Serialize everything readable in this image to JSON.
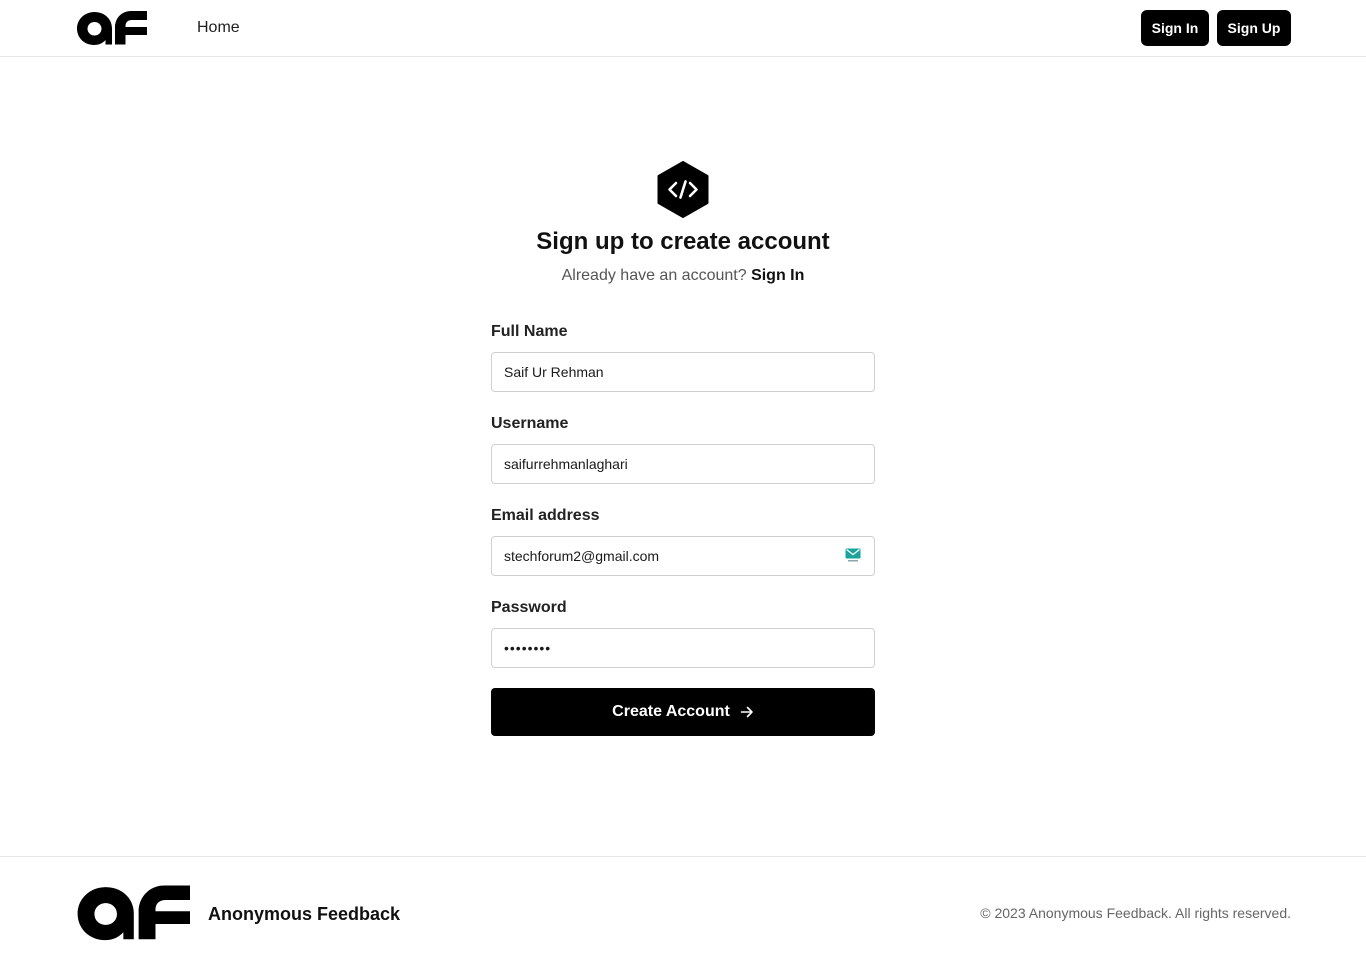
{
  "nav": {
    "logo_icon": "af-logo-icon",
    "home_label": "Home",
    "signin_label": "Sign In",
    "signup_label": "Sign Up"
  },
  "main": {
    "hero_icon": "code-hexagon-icon",
    "title": "Sign up to create account",
    "subtitle_prefix": "Already have an account?",
    "subtitle_link": "Sign In"
  },
  "form": {
    "fields": [
      {
        "label": "Full Name",
        "value": "Saif Ur Rehman"
      },
      {
        "label": "Username",
        "value": "saifurrehmanlaghari"
      },
      {
        "label": "Email address",
        "value": "stechforum2@gmail.com"
      },
      {
        "label": "Password",
        "value": "••••••••"
      }
    ],
    "email_badge_icon": "email-extension-icon",
    "submit_label": "Create Account",
    "submit_icon": "arrow-right-icon"
  },
  "footer": {
    "logo_icon": "af-logo-icon",
    "brand_name": "Anonymous Feedback",
    "copyright": "© 2023 Anonymous Feedback. All rights reserved."
  },
  "colors": {
    "primary": "#000000",
    "background": "#ffffff",
    "border": "#cfcfcf",
    "muted_text": "#555555",
    "email_badge": "#1aa39a"
  }
}
